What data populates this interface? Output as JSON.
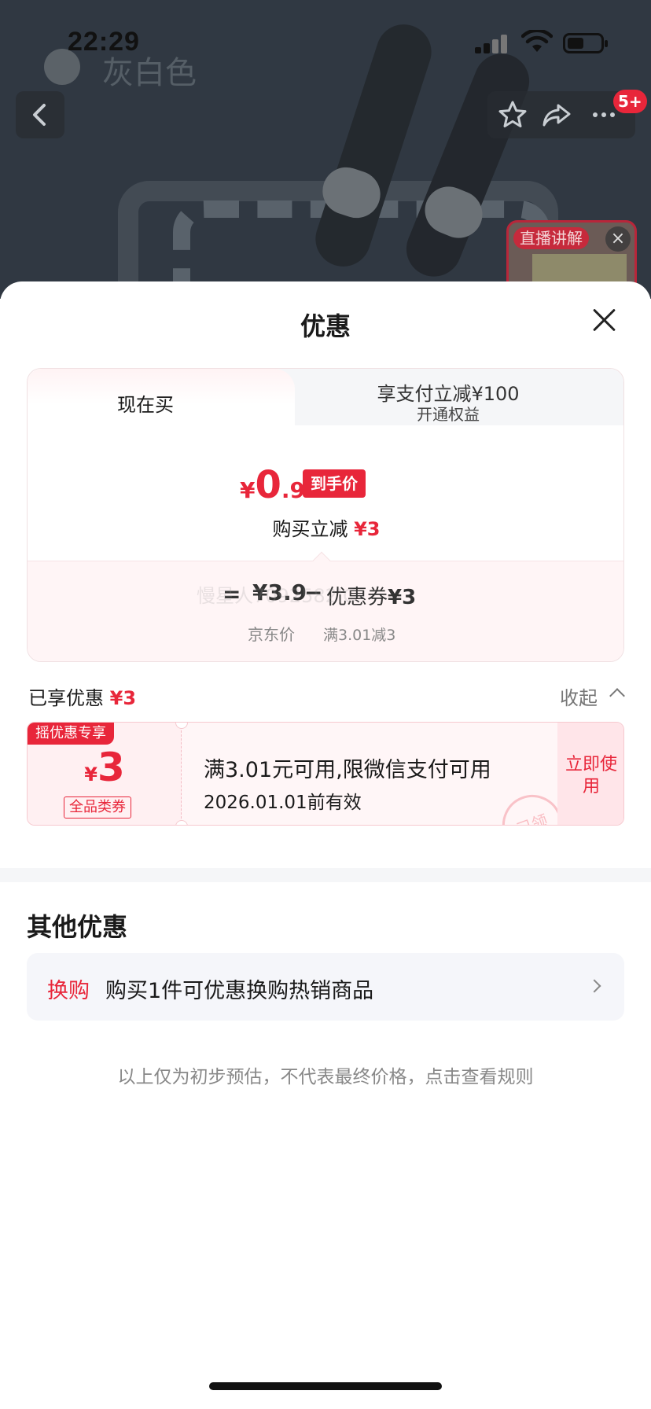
{
  "status_bar": {
    "time": "22:29"
  },
  "background": {
    "product_title": "灰白色",
    "cart_badge": "5+",
    "live_tag": "直播讲解"
  },
  "sheet": {
    "title": "优惠",
    "tabs": [
      {
        "label": "现在买"
      },
      {
        "label": "享支付立减¥100",
        "sublabel": "开通权益"
      }
    ],
    "final_price": {
      "currency": "¥",
      "integer": "0",
      "decimal": ".9",
      "tag": "到手价"
    },
    "reduce": {
      "label": "购买立减",
      "amount": "¥3"
    },
    "calc": {
      "eq": "=",
      "jd_price": "¥3.9",
      "jd_label": "京东价",
      "minus": "−",
      "coupon_label": "优惠券",
      "coupon_value": "¥3",
      "coupon_cond": "满3.01减3"
    },
    "watermark": "慢星人7092582IC",
    "enjoyed": {
      "label": "已享优惠",
      "amount": "¥3",
      "collapse": "收起"
    },
    "coupon": {
      "ribbon": "摇优惠专享",
      "currency": "¥",
      "amount": "3",
      "type": "全品类券",
      "desc": "满3.01元可用,限微信支付可用",
      "valid": "2026.01.01前有效",
      "use_label": "立即使用",
      "stamp": "已领"
    },
    "other": {
      "title": "其他优惠",
      "tag": "换购",
      "desc": "购买1件可优惠换购热销商品"
    },
    "disclaimer": "以上仅为初步预估，不代表最终价格，点击查看规则"
  },
  "colors": {
    "accent": "#e8263a",
    "coupon_bg": "#fff6f7",
    "muted": "#888888"
  },
  "icons": [
    "back-icon",
    "star-icon",
    "share-icon",
    "more-icon",
    "close-icon",
    "chevron-up-icon",
    "chevron-right-icon"
  ]
}
